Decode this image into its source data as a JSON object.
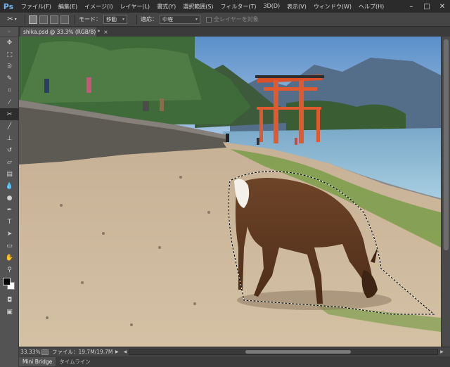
{
  "app": {
    "logo": "Ps"
  },
  "menu": [
    "ファイル(F)",
    "編集(E)",
    "イメージ(I)",
    "レイヤー(L)",
    "書式(Y)",
    "選択範囲(S)",
    "フィルター(T)",
    "3D(D)",
    "表示(V)",
    "ウィンドウ(W)",
    "ヘルプ(H)"
  ],
  "window_controls": {
    "minimize": "–",
    "maximize": "□",
    "close": "✕"
  },
  "options": {
    "tool_icon": "✂",
    "tool_arrow": "▾",
    "mode_label": "モード：",
    "mode_value": "移動",
    "adapt_label": "適応：",
    "adapt_value": "中程",
    "sample_all_label": "全レイヤーを対象"
  },
  "document": {
    "tab_title": "shika.psd @ 33.3% (RGB/8) *",
    "close": "×"
  },
  "status": {
    "zoom": "33.33%",
    "file_info": "ファイル：19.7M/19.7M",
    "arrow_right": "▶",
    "arrow_left": "◀"
  },
  "panels": [
    "Mini Bridge",
    "タイムライン"
  ],
  "tools": [
    {
      "name": "move-tool-icon",
      "glyph": "✥"
    },
    {
      "name": "marquee-tool-icon",
      "glyph": "⬚"
    },
    {
      "name": "lasso-tool-icon",
      "glyph": "ᘐ"
    },
    {
      "name": "quick-select-tool-icon",
      "glyph": "✎"
    },
    {
      "name": "crop-tool-icon",
      "glyph": "⌗"
    },
    {
      "name": "eyedropper-tool-icon",
      "glyph": "⁄"
    },
    {
      "name": "content-aware-move-tool-icon",
      "glyph": "✂",
      "active": true
    },
    {
      "name": "brush-tool-icon",
      "glyph": "╱"
    },
    {
      "name": "stamp-tool-icon",
      "glyph": "⊥"
    },
    {
      "name": "history-brush-tool-icon",
      "glyph": "↺"
    },
    {
      "name": "eraser-tool-icon",
      "glyph": "▱"
    },
    {
      "name": "gradient-tool-icon",
      "glyph": "▤"
    },
    {
      "name": "blur-tool-icon",
      "glyph": "💧"
    },
    {
      "name": "dodge-tool-icon",
      "glyph": "●"
    },
    {
      "name": "pen-tool-icon",
      "glyph": "✒"
    },
    {
      "name": "type-tool-icon",
      "glyph": "T"
    },
    {
      "name": "path-select-tool-icon",
      "glyph": "➤"
    },
    {
      "name": "shape-tool-icon",
      "glyph": "▭"
    },
    {
      "name": "hand-tool-icon",
      "glyph": "✋"
    },
    {
      "name": "zoom-tool-icon",
      "glyph": "⚲"
    }
  ],
  "colors": {
    "foreground": "#000000",
    "background": "#ffffff"
  }
}
